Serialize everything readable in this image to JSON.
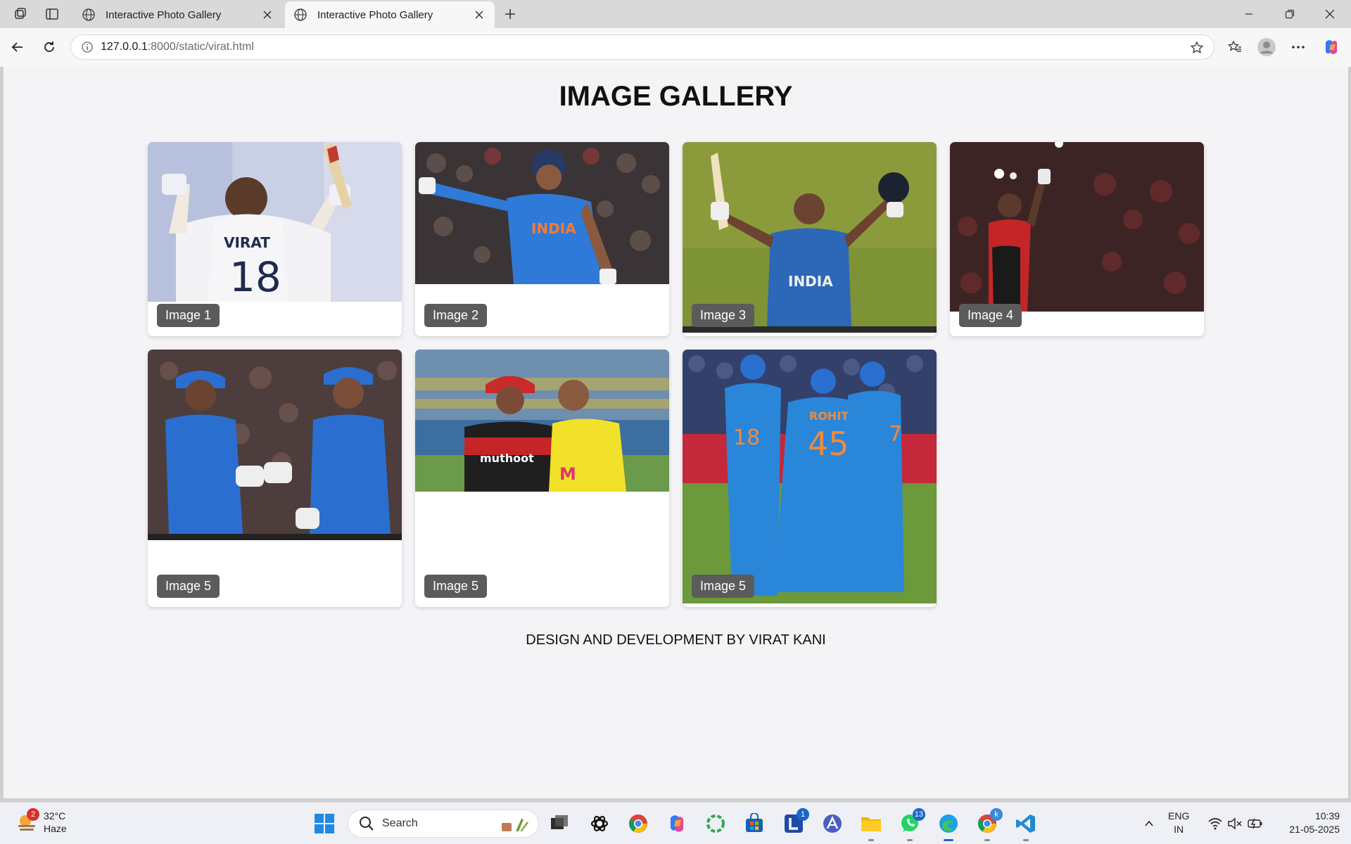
{
  "browser": {
    "tabs": [
      {
        "title": "Interactive Photo Gallery",
        "active": false
      },
      {
        "title": "Interactive Photo Gallery",
        "active": true
      }
    ],
    "url_host": "127.0.0.1",
    "url_rest": ":8000/static/virat.html"
  },
  "page": {
    "title": "IMAGE GALLERY",
    "images": [
      {
        "caption": "Image 1",
        "scene": "white-jersey-bat-raised"
      },
      {
        "caption": "Image 2",
        "scene": "blue-jersey-celebration"
      },
      {
        "caption": "Image 3",
        "scene": "bat-and-helmet-raised"
      },
      {
        "caption": "Image 4",
        "scene": "red-jersey-night"
      },
      {
        "caption": "Image 5",
        "scene": "two-players-handshake"
      },
      {
        "caption": "Image 5",
        "scene": "red-and-yellow-jerseys"
      },
      {
        "caption": "Image 5",
        "scene": "three-players-back"
      }
    ],
    "footer": "DESIGN AND DEVELOPMENT BY VIRAT KANI"
  },
  "taskbar": {
    "weather_temp": "32°C",
    "weather_desc": "Haze",
    "weather_badge": "2",
    "search_label": "Search",
    "lang_top": "ENG",
    "lang_bottom": "IN",
    "time": "10:39",
    "date": "21-05-2025",
    "badges": {
      "linkedin": "1",
      "whatsapp": "13",
      "chrome_profile": "k"
    }
  },
  "colors": {
    "page_bg": "#f4f4f7",
    "caption_bg": "#5b5b5b",
    "accent_blue": "#1a66c9"
  }
}
